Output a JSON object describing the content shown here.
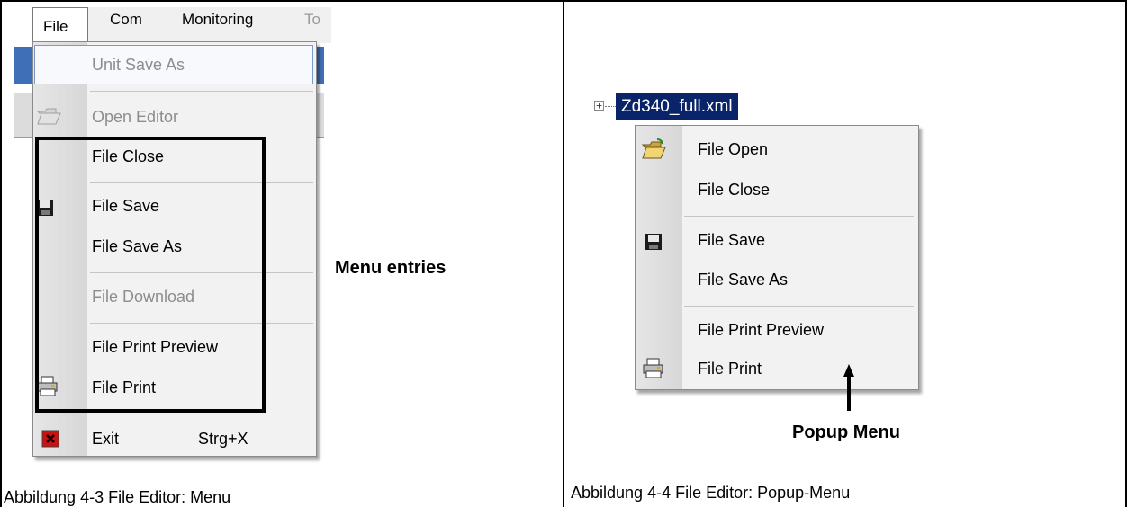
{
  "menubar": {
    "items": [
      "File",
      "Com",
      "Monitoring",
      "To"
    ]
  },
  "file_menu": {
    "unit_save_as": "Unit Save As",
    "open_editor": "Open Editor",
    "file_close": "File Close",
    "file_save": "File Save",
    "file_save_as": "File Save As",
    "file_download": "File Download",
    "file_print_preview": "File Print Preview",
    "file_print": "File Print",
    "exit": "Exit",
    "exit_shortcut": "Strg+X"
  },
  "annotations": {
    "menu_entries": "Menu entries",
    "popup_menu": "Popup Menu"
  },
  "tree": {
    "toggle": "+",
    "node": "Zd340_full.xml"
  },
  "popup_menu": {
    "file_open": "File Open",
    "file_close": "File Close",
    "file_save": "File Save",
    "file_save_as": "File Save As",
    "file_print_preview": "File Print Preview",
    "file_print": "File Print"
  },
  "captions": {
    "left_label": "Abbildung 4-3",
    "left_text": "File Editor: Menu",
    "right_label": "Abbildung 4-4",
    "right_text": "File Editor: Popup-Menu"
  },
  "icons": [
    "folder-open-icon",
    "floppy-disk-icon",
    "printer-icon",
    "exit-icon"
  ],
  "colors": {
    "selection": "#0a246a",
    "exit_icon": "#cc1111",
    "disabled_text": "#8d8d8d"
  }
}
